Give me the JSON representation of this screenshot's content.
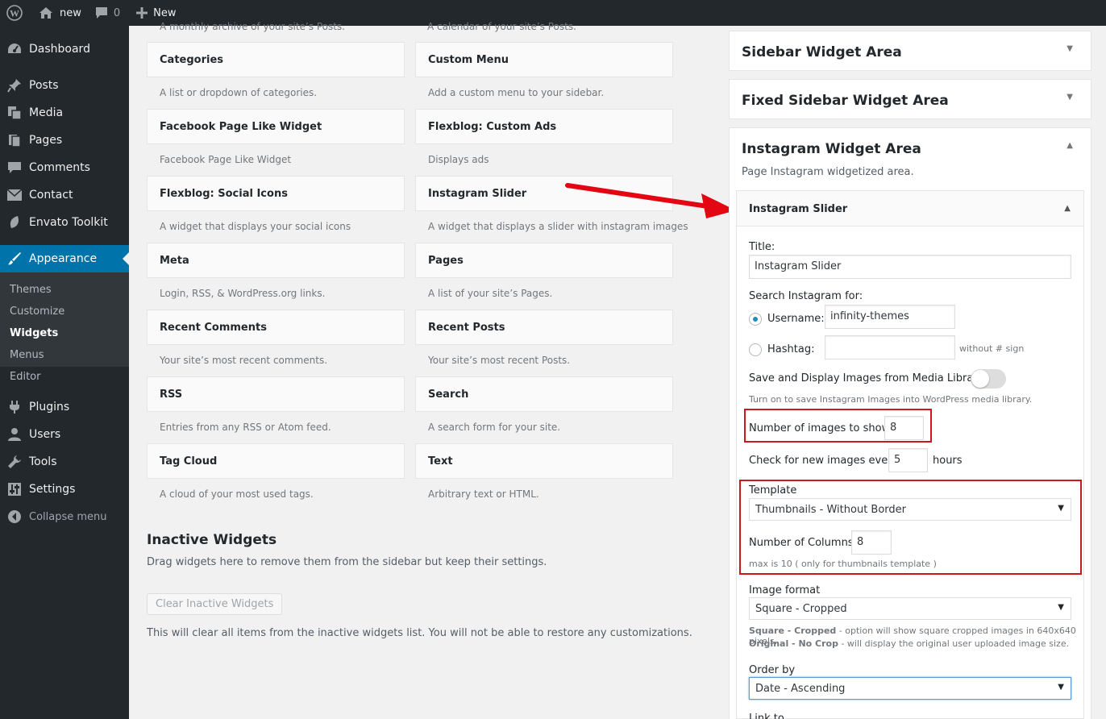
{
  "admin_bar": {
    "site_name": "new",
    "comments_count": "0",
    "new_label": "New"
  },
  "menu": {
    "items": [
      {
        "label": "Dashboard",
        "icon": "dashboard-icon"
      },
      {
        "label": "Posts",
        "icon": "pin-icon"
      },
      {
        "label": "Media",
        "icon": "media-icon"
      },
      {
        "label": "Pages",
        "icon": "pages-icon"
      },
      {
        "label": "Comments",
        "icon": "comments-icon"
      },
      {
        "label": "Contact",
        "icon": "envelope-icon"
      },
      {
        "label": "Envato Toolkit",
        "icon": "leaf-icon"
      },
      {
        "label": "Appearance",
        "icon": "brush-icon"
      },
      {
        "label": "Plugins",
        "icon": "plug-icon"
      },
      {
        "label": "Users",
        "icon": "user-icon"
      },
      {
        "label": "Tools",
        "icon": "wrench-icon"
      },
      {
        "label": "Settings",
        "icon": "sliders-icon"
      },
      {
        "label": "Collapse menu",
        "icon": "collapse-icon"
      }
    ],
    "submenu": [
      "Themes",
      "Customize",
      "Widgets",
      "Menus",
      "Editor"
    ]
  },
  "available_widgets": {
    "cut_descriptions": [
      "A monthly archive of your site’s Posts.",
      "A calendar of your site’s Posts."
    ],
    "rows": [
      [
        {
          "title": "Categories",
          "desc": "A list or dropdown of categories."
        },
        {
          "title": "Custom Menu",
          "desc": "Add a custom menu to your sidebar."
        }
      ],
      [
        {
          "title": "Facebook Page Like Widget",
          "desc": "Facebook Page Like Widget"
        },
        {
          "title": "Flexblog: Custom Ads",
          "desc": "Displays ads"
        }
      ],
      [
        {
          "title": "Flexblog: Social Icons",
          "desc": "A widget that displays your social icons"
        },
        {
          "title": "Instagram Slider",
          "desc": "A widget that displays a slider with instagram images"
        }
      ],
      [
        {
          "title": "Meta",
          "desc": "Login, RSS, & WordPress.org links."
        },
        {
          "title": "Pages",
          "desc": "A list of your site’s Pages."
        }
      ],
      [
        {
          "title": "Recent Comments",
          "desc": "Your site’s most recent comments."
        },
        {
          "title": "Recent Posts",
          "desc": "Your site’s most recent Posts."
        }
      ],
      [
        {
          "title": "RSS",
          "desc": "Entries from any RSS or Atom feed."
        },
        {
          "title": "Search",
          "desc": "A search form for your site."
        }
      ],
      [
        {
          "title": "Tag Cloud",
          "desc": "A cloud of your most used tags."
        },
        {
          "title": "Text",
          "desc": "Arbitrary text or HTML."
        }
      ]
    ]
  },
  "inactive": {
    "title": "Inactive Widgets",
    "desc": "Drag widgets here to remove them from the sidebar but keep their settings.",
    "clear_button": "Clear Inactive Widgets",
    "clear_desc": "This will clear all items from the inactive widgets list. You will not be able to restore any customizations."
  },
  "sidebars": {
    "sidebar_widget_area": "Sidebar Widget Area",
    "fixed_sidebar_widget_area": "Fixed Sidebar Widget Area",
    "instagram_widget_area": "Instagram Widget Area",
    "instagram_widget_area_desc": "Page Instagram widgetized area."
  },
  "instagram_slider": {
    "header": "Instagram Slider",
    "title_label": "Title:",
    "title_value": "Instagram Slider",
    "search_label": "Search Instagram for:",
    "username_label": "Username:",
    "username_value": "infinity-themes",
    "hashtag_label": "Hashtag:",
    "hashtag_value": "",
    "hashtag_hint": "without # sign",
    "save_label": "Save and Display Images from Media Library:",
    "save_hint": "Turn on to save Instagram Images into WordPress media library.",
    "num_images_label": "Number of images to show:",
    "num_images_value": "8",
    "check_label": "Check for new images every:",
    "check_value": "5",
    "check_unit": "hours",
    "template_label": "Template",
    "template_value": "Thumbnails - Without Border",
    "columns_label": "Number of Columns:",
    "columns_value": "8",
    "columns_hint": "max is 10 ( only for thumbnails template )",
    "image_format_label": "Image format",
    "image_format_value": "Square - Cropped",
    "format_hint1_strong": "Square - Cropped",
    "format_hint1": " - option will show square cropped images in 640x640 pixels.",
    "format_hint2_strong": "Original - No Crop",
    "format_hint2": " - will display the original user uploaded image size.",
    "order_label": "Order by",
    "order_value": "Date - Ascending",
    "link_label": "Link to"
  },
  "colors": {
    "admin_dark": "#23282d",
    "accent_blue": "#0073aa",
    "annotation_red": "#e30613"
  }
}
